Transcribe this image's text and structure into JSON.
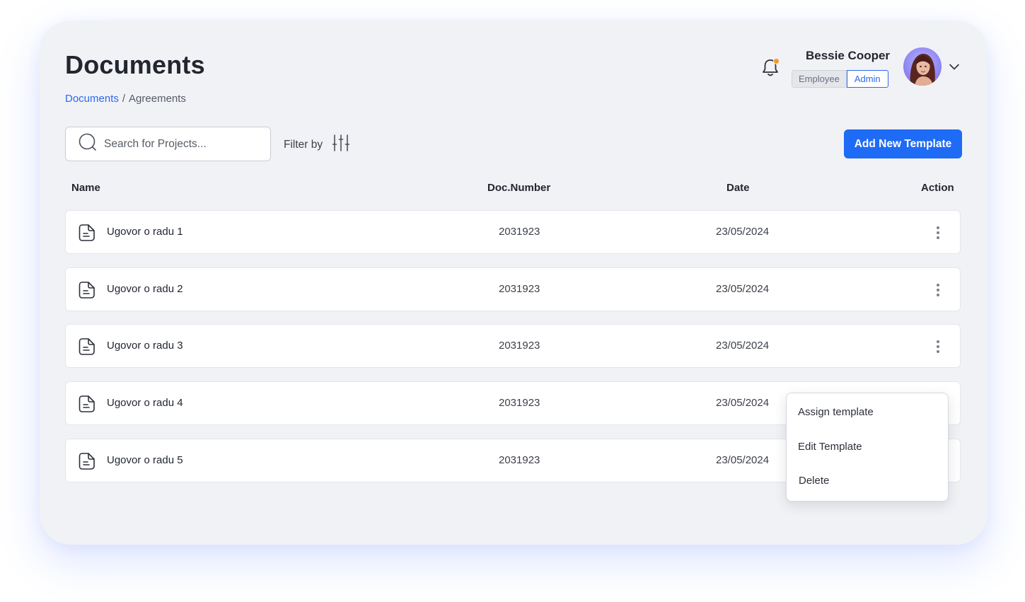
{
  "page": {
    "title": "Documents"
  },
  "breadcrumb": {
    "root": "Documents",
    "separator": "/",
    "current": "Agreements"
  },
  "user": {
    "name": "Bessie Cooper",
    "roles": [
      "Employee",
      "Admin"
    ],
    "active_role": "Admin"
  },
  "toolbar": {
    "search_placeholder": "Search for Projects...",
    "filter_label": "Filter by",
    "add_button": "Add New Template"
  },
  "table": {
    "columns": [
      "Name",
      "Doc.Number",
      "Date",
      "Action"
    ],
    "rows": [
      {
        "name": "Ugovor o radu 1",
        "doc_number": "2031923",
        "date": "23/05/2024"
      },
      {
        "name": "Ugovor o radu 2",
        "doc_number": "2031923",
        "date": "23/05/2024"
      },
      {
        "name": "Ugovor o radu 3",
        "doc_number": "2031923",
        "date": "23/05/2024"
      },
      {
        "name": "Ugovor o radu 4",
        "doc_number": "2031923",
        "date": "23/05/2024"
      },
      {
        "name": "Ugovor o radu 5",
        "doc_number": "2031923",
        "date": "23/05/2024"
      }
    ]
  },
  "action_menu": {
    "items": [
      "Assign template",
      "Edit Template",
      "Delete"
    ]
  },
  "colors": {
    "accent": "#1e6bf5",
    "notification_dot": "#f59a23",
    "background": "#f1f2f6"
  }
}
